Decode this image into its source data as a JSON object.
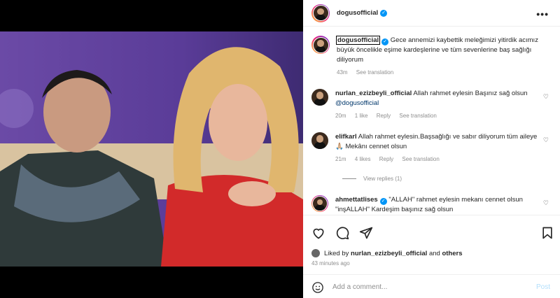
{
  "post": {
    "username": "dogusofficial",
    "more_label": "•••"
  },
  "caption": {
    "username": "dogusofficial",
    "text": "Gece annemizi kaybettik meleğimizi yitirdik acımız büyük öncelikle eşime kardeşlerine ve tüm sevenlerine baş sağlığı diliyorum",
    "time": "43m",
    "see_translation": "See translation"
  },
  "comments": [
    {
      "username": "nurlan_ezizbeyli_official",
      "text": "Allah rahmet eylesin Başınız sağ olsun",
      "mention": "@dogusofficial",
      "time": "20m",
      "likes": "1 like",
      "reply": "Reply",
      "see_translation": "See translation"
    },
    {
      "username": "elifkarl",
      "text": "Allah rahmet eylesin.Başsağlığı ve sabır diliyorum tüm aileye",
      "emoji": "🙏🏼",
      "text2": "Mekânı cennet olsun",
      "time": "21m",
      "likes": "4 likes",
      "reply": "Reply",
      "see_translation": "See translation",
      "view_replies": "View replies (1)"
    },
    {
      "username": "ahmettatlises",
      "text": "\"ALLAH\" rahmet eylesin mekanı cennet olsun \"inşALLAH\" Kardeşim başınız sağ olsun"
    }
  ],
  "likes_line": {
    "prefix": "Liked by",
    "user": "nurlan_ezizbeyli_official",
    "and": "and",
    "others": "others"
  },
  "timestamp": "43 minutes ago",
  "add_comment": {
    "placeholder": "Add a comment...",
    "post_label": "Post"
  },
  "colors": {
    "verified": "#0095f6",
    "link": "#00376b",
    "muted": "#8e8e8e",
    "post_disabled": "#b2dffc"
  }
}
